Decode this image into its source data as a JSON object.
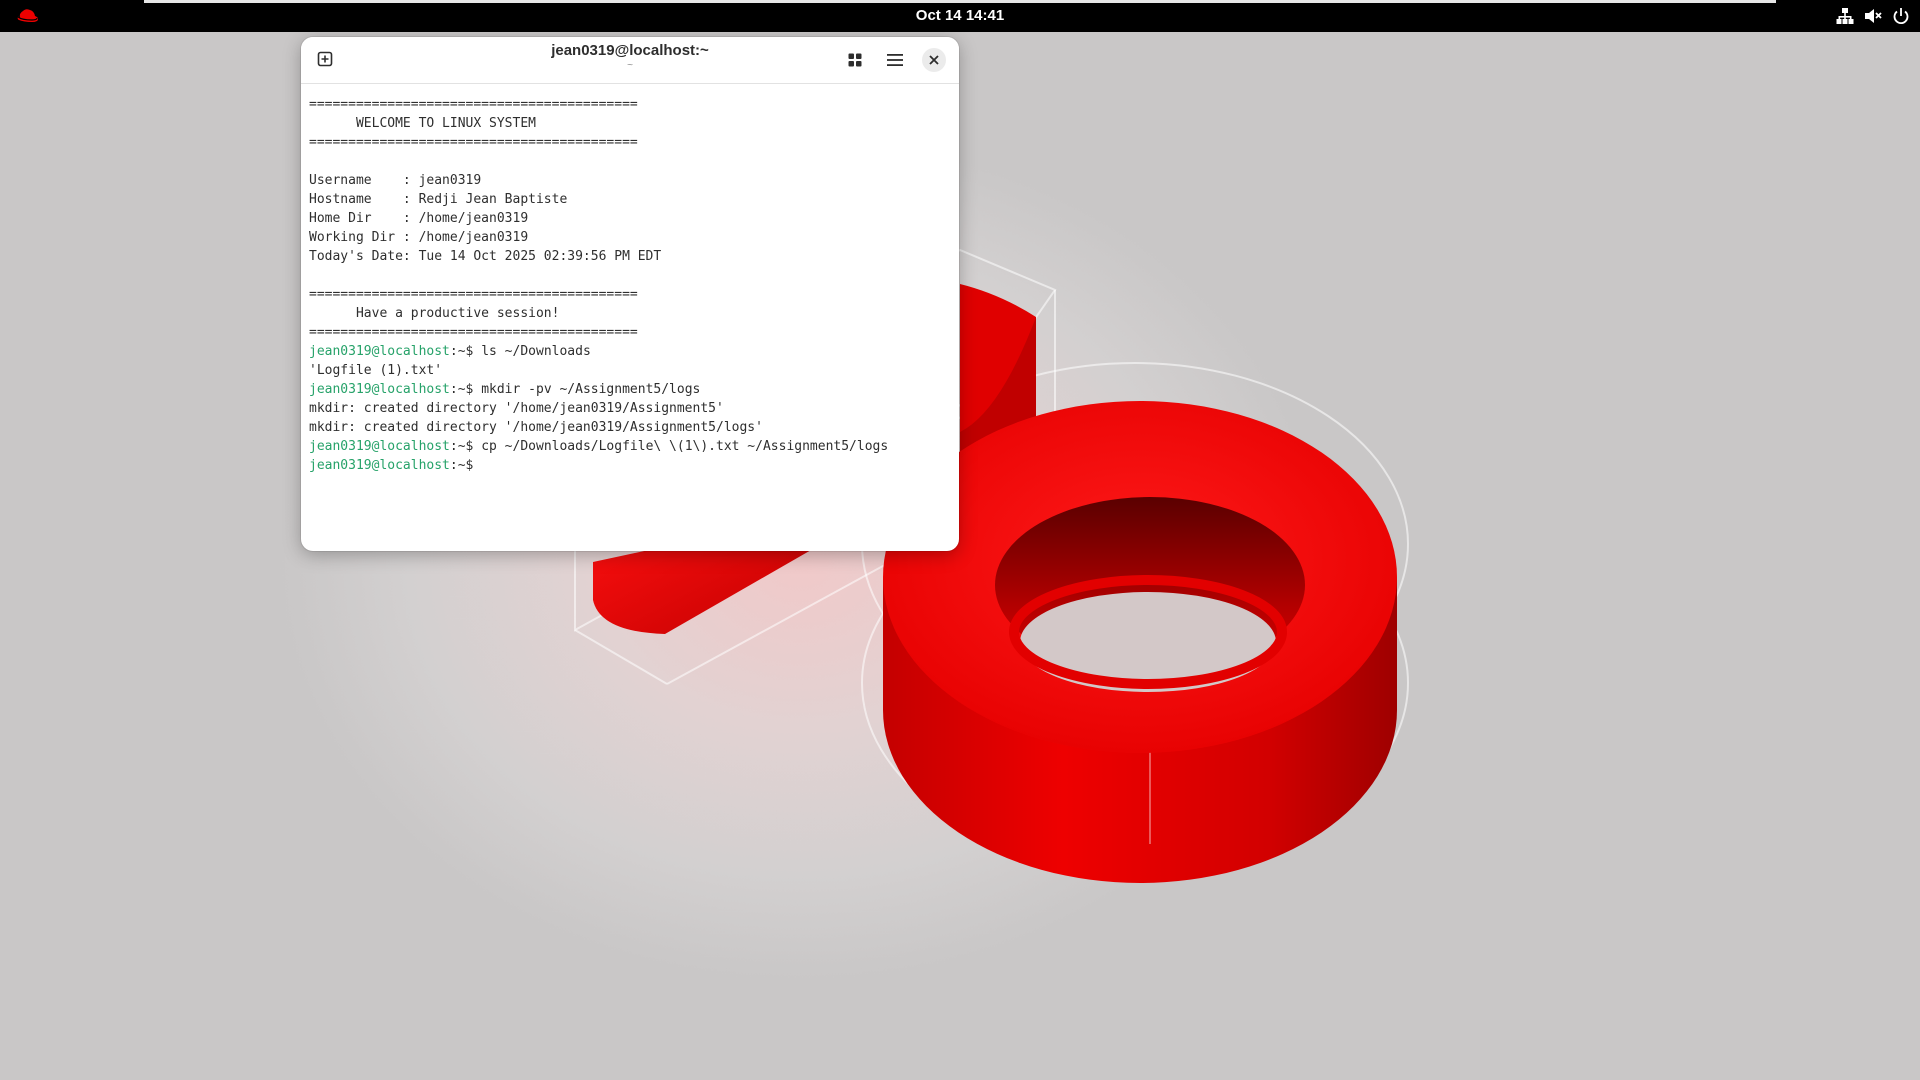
{
  "topbar": {
    "clock": "Oct 14  14:41",
    "activities_icon": "redhat-logo-icon",
    "tray_icons": [
      "network-wired-icon",
      "volume-muted-icon",
      "power-icon"
    ]
  },
  "terminal": {
    "title": "jean0319@localhost:~",
    "subtitle": "~",
    "buttons": {
      "new_tab_icon": "new-tab-icon",
      "grid_icon": "grid-view-icon",
      "menu_icon": "hamburger-menu-icon",
      "close_icon": "close-icon"
    },
    "colors": {
      "prompt": "#26a269",
      "text": "#2e2e2e",
      "background": "#ffffff"
    },
    "lines": [
      {
        "type": "text",
        "text": "=========================================="
      },
      {
        "type": "text",
        "text": "      WELCOME TO LINUX SYSTEM"
      },
      {
        "type": "text",
        "text": "=========================================="
      },
      {
        "type": "text",
        "text": ""
      },
      {
        "type": "text",
        "text": "Username    : jean0319"
      },
      {
        "type": "text",
        "text": "Hostname    : Redji Jean Baptiste"
      },
      {
        "type": "text",
        "text": "Home Dir    : /home/jean0319"
      },
      {
        "type": "text",
        "text": "Working Dir : /home/jean0319"
      },
      {
        "type": "text",
        "text": "Today's Date: Tue 14 Oct 2025 02:39:56 PM EDT"
      },
      {
        "type": "text",
        "text": ""
      },
      {
        "type": "text",
        "text": "=========================================="
      },
      {
        "type": "text",
        "text": "      Have a productive session!"
      },
      {
        "type": "text",
        "text": "=========================================="
      },
      {
        "type": "prompt",
        "user": "jean0319@localhost",
        "rest": ":~$ ",
        "cmd": "ls ~/Downloads"
      },
      {
        "type": "text",
        "text": "'Logfile (1).txt'"
      },
      {
        "type": "prompt",
        "user": "jean0319@localhost",
        "rest": ":~$ ",
        "cmd": "mkdir -pv ~/Assignment5/logs"
      },
      {
        "type": "text",
        "text": "mkdir: created directory '/home/jean0319/Assignment5'"
      },
      {
        "type": "text",
        "text": "mkdir: created directory '/home/jean0319/Assignment5/logs'"
      },
      {
        "type": "prompt",
        "user": "jean0319@localhost",
        "rest": ":~$ ",
        "cmd": "cp ~/Downloads/Logfile\\ \\(1\\).txt ~/Assignment5/logs"
      },
      {
        "type": "prompt",
        "user": "jean0319@localhost",
        "rest": ":~$ ",
        "cmd": ""
      }
    ]
  },
  "wallpaper": {
    "accent": "#ee0000",
    "accent_dark": "#8a0000",
    "background": "#d3d0d0"
  }
}
